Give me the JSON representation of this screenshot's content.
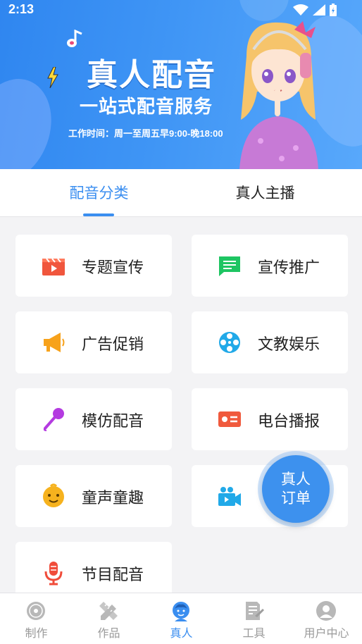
{
  "status_bar": {
    "time": "2:13"
  },
  "banner": {
    "title": "真人配音",
    "subtitle": "一站式配音服务",
    "hours": "工作时间：周一至周五早9:00-晚18:00"
  },
  "tabs": [
    {
      "label": "配音分类",
      "active": true
    },
    {
      "label": "真人主播",
      "active": false
    }
  ],
  "categories": [
    {
      "label": "专题宣传",
      "icon": "clapperboard-icon",
      "color": "#f0563d"
    },
    {
      "label": "宣传推广",
      "icon": "chat-bubble-icon",
      "color": "#1ec562"
    },
    {
      "label": "广告促销",
      "icon": "megaphone-icon",
      "color": "#f7a21b"
    },
    {
      "label": "文教娱乐",
      "icon": "film-reel-icon",
      "color": "#21a9e8"
    },
    {
      "label": "模仿配音",
      "icon": "microphone-icon",
      "color": "#b43be0"
    },
    {
      "label": "电台播报",
      "icon": "id-card-icon",
      "color": "#f05a3d"
    },
    {
      "label": "童声童趣",
      "icon": "child-face-icon",
      "color": "#f6b21e"
    },
    {
      "label": "",
      "icon": "video-camera-icon",
      "color": "#21a9e8"
    },
    {
      "label": "节目配音",
      "icon": "podcast-mic-icon",
      "color": "#f04c3a"
    }
  ],
  "fab": {
    "line1": "真人",
    "line2": "订单"
  },
  "bottom_nav": [
    {
      "label": "制作",
      "icon": "disc-icon",
      "active": false
    },
    {
      "label": "作品",
      "icon": "pencil-ruler-icon",
      "active": false
    },
    {
      "label": "真人",
      "icon": "person-icon",
      "active": true
    },
    {
      "label": "工具",
      "icon": "document-tool-icon",
      "active": false
    },
    {
      "label": "用户中心",
      "icon": "user-circle-icon",
      "active": false
    }
  ],
  "colors": {
    "accent": "#3a8ef0",
    "banner": "#3f95f5"
  }
}
